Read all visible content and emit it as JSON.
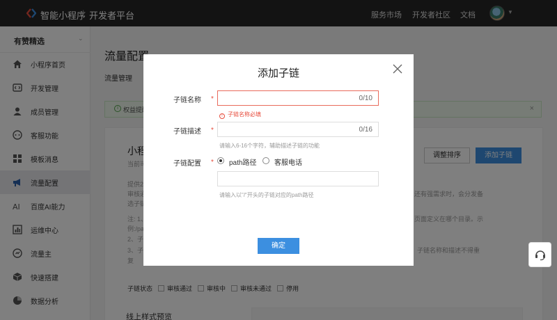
{
  "topbar": {
    "brand": "智能小程序",
    "separator": "|",
    "platform": "开发者平台",
    "nav": [
      "服务市场",
      "开发者社区",
      "文档"
    ]
  },
  "sidebar": {
    "shop_name": "有赞精选",
    "items": [
      {
        "label": "小程序首页",
        "icon": "home-icon"
      },
      {
        "label": "开发管理",
        "icon": "code-icon"
      },
      {
        "label": "成员管理",
        "icon": "user-icon"
      },
      {
        "label": "客服功能",
        "icon": "chat-icon"
      },
      {
        "label": "模板消息",
        "icon": "template-icon"
      },
      {
        "label": "流量配置",
        "icon": "megaphone-icon",
        "active": true
      },
      {
        "label": "百度AI能力",
        "icon": "ai-icon"
      },
      {
        "label": "运维中心",
        "icon": "chart-icon"
      },
      {
        "label": "流量主",
        "icon": "coin-icon"
      },
      {
        "label": "快速搭建",
        "icon": "cube-icon"
      },
      {
        "label": "数据分析",
        "icon": "pie-icon"
      }
    ]
  },
  "main": {
    "title": "流量配置",
    "subtab": "流量管理",
    "notice": "权益提醒",
    "notice_close": "×",
    "card_title": "小程",
    "card_sub": "当前可",
    "adjust_button": "调整排序",
    "add_button": "添加子链",
    "lines": [
      "提供2",
      "审核通",
      "选子链",
      "注: 1、",
      "例:/pa",
      "2、子",
      "3、子",
      "复"
    ],
    "right_lines": [
      "还有强需求时，会分发备",
      "页面定义在哪个目录。示",
      "子链名称和描述不得重"
    ],
    "status_label": "子链状态",
    "status_options": [
      "审核通过",
      "审核中",
      "审核未通过",
      "停用"
    ],
    "preview_title": "线上样式预览"
  },
  "modal": {
    "title": "添加子链",
    "name_label": "子链名称",
    "name_value": "",
    "name_counter": "0/10",
    "name_error": "子链名称必填",
    "desc_label": "子链描述",
    "desc_value": "",
    "desc_counter": "0/16",
    "desc_hint": "请输入6-16个字符，辅助描述子链的功能",
    "config_label": "子链配置",
    "radio_path": "path路径",
    "radio_service": "客服电话",
    "path_value": "",
    "path_hint": "请输入以\"/\"开头的子链对应的path路径",
    "required_mark": "*",
    "confirm": "确定"
  },
  "colors": {
    "topbar": "#262626",
    "primary": "#3c8fe0",
    "error": "#e74c3c",
    "notice_bg": "#eef9ec"
  }
}
